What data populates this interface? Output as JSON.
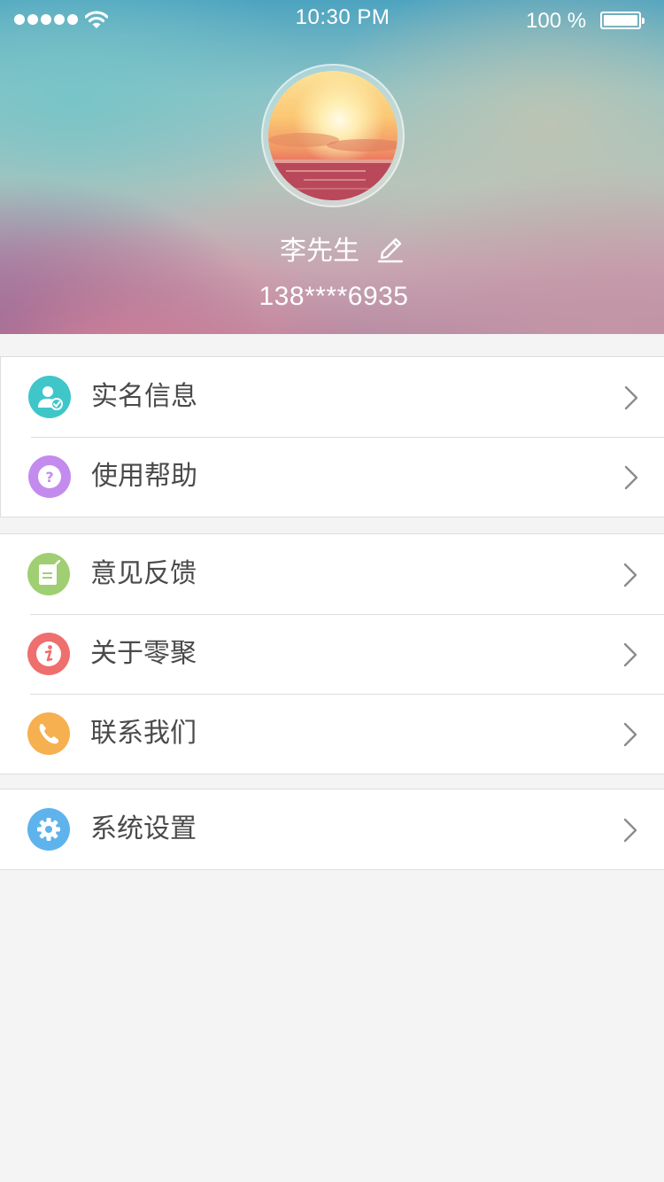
{
  "status_bar": {
    "time": "10:30 PM",
    "battery_percent": "100 %",
    "signal_bars": 5
  },
  "profile": {
    "name": "李先生",
    "phone": "138****6935"
  },
  "menu": {
    "group1": [
      {
        "label": "实名信息",
        "icon": "verified-user-icon",
        "color": "#3fc6c9"
      },
      {
        "label": "使用帮助",
        "icon": "help-question-icon",
        "color": "#c48bef"
      }
    ],
    "group2": [
      {
        "label": "意见反馈",
        "icon": "feedback-note-icon",
        "color": "#9fcf72"
      },
      {
        "label": "关于零聚",
        "icon": "info-icon",
        "color": "#ef6e6e"
      },
      {
        "label": "联系我们",
        "icon": "phone-icon",
        "color": "#f6b04f"
      }
    ],
    "group3": [
      {
        "label": "系统设置",
        "icon": "settings-gear-icon",
        "color": "#5eb3ec"
      }
    ]
  },
  "colors": {
    "page_background": "#f4f4f4",
    "label_text": "#4a4a4a",
    "chevron": "#8c8c8c"
  }
}
